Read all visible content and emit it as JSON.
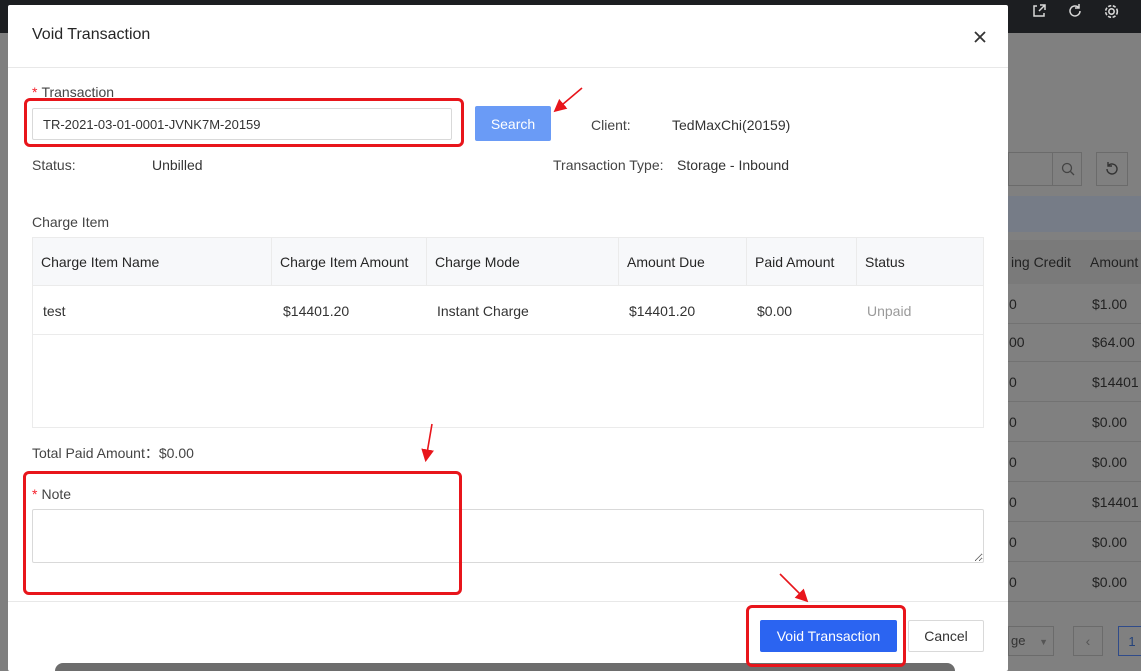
{
  "dialog": {
    "title": "Void Transaction",
    "transaction_label": "Transaction",
    "transaction_value": "TR-2021-03-01-0001-JVNK7M-20159",
    "search_label": "Search",
    "client_label": "Client:",
    "client_value": "TedMaxChi(20159)",
    "status_label": "Status:",
    "status_value": "Unbilled",
    "type_label": "Transaction Type:",
    "type_value": "Storage - Inbound",
    "charge_item_title": "Charge Item",
    "table": {
      "columns": [
        "Charge Item Name",
        "Charge Item Amount",
        "Charge Mode",
        "Amount Due",
        "Paid Amount",
        "Status"
      ],
      "rows": [
        [
          "test",
          "$14401.20",
          "Instant Charge",
          "$14401.20",
          "$0.00",
          "Unpaid"
        ]
      ]
    },
    "total_paid_label": "Total Paid Amount：",
    "total_paid_value": "$0.00",
    "note_label": "Note",
    "note_value": "",
    "void_label": "Void Transaction",
    "cancel_label": "Cancel",
    "required_mark": "*"
  },
  "background": {
    "header_col1": "ing Credit",
    "header_col2": "Amount",
    "rows": [
      [
        "0",
        "$1.00"
      ],
      [
        "00",
        "$64.00"
      ],
      [
        "0",
        "$14401"
      ],
      [
        "0",
        "$0.00"
      ],
      [
        "0",
        "$0.00"
      ],
      [
        "0",
        "$14401"
      ],
      [
        "0",
        "$0.00"
      ],
      [
        "0",
        "$0.00"
      ]
    ],
    "page_size_text": "ge",
    "current_page": "1"
  },
  "colors": {
    "primary": "#2b64f1",
    "search_button": "#6a9bf6",
    "required": "#f5222d",
    "annotation": "#e8151b"
  }
}
